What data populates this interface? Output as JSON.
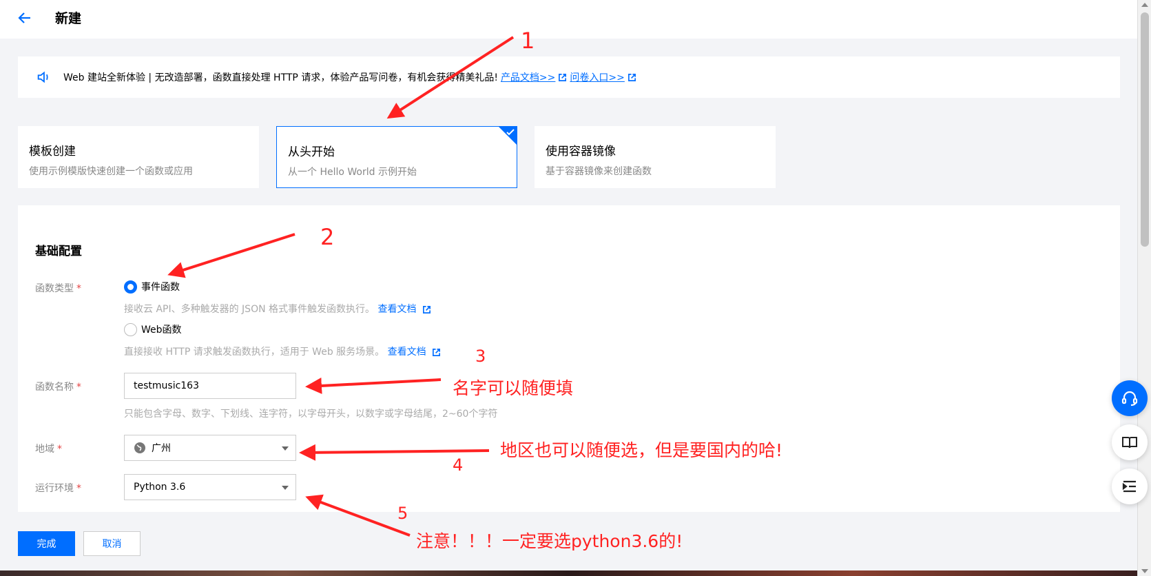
{
  "header": {
    "title": "新建"
  },
  "notice": {
    "text": "Web 建站全新体验 | 无改造部署，函数直接处理 HTTP 请求，体验产品写问卷，有机会获得精美礼品!",
    "link1": "产品文档>>",
    "link2": "问卷入口>>"
  },
  "cards": [
    {
      "title": "模板创建",
      "desc": "使用示例模版快速创建一个函数或应用"
    },
    {
      "title": "从头开始",
      "desc": "从一个 Hello World 示例开始"
    },
    {
      "title": "使用容器镜像",
      "desc": "基于容器镜像来创建函数"
    }
  ],
  "form": {
    "section_title": "基础配置",
    "type_label": "函数类型",
    "required_mark": "*",
    "radio_event": "事件函数",
    "radio_event_help": "接收云 API、多种触发器的 JSON 格式事件触发函数执行。",
    "radio_web": "Web函数",
    "radio_web_help": "直接接收 HTTP 请求触发函数执行，适用于 Web 服务场景。",
    "doc_link": "查看文档",
    "name_label": "函数名称",
    "name_value": "testmusic163",
    "name_help": "只能包含字母、数字、下划线、连字符，以字母开头，以数字或字母结尾，2~60个字符",
    "region_label": "地域",
    "region_value": "广州",
    "runtime_label": "运行环境",
    "runtime_value": "Python 3.6"
  },
  "buttons": {
    "done": "完成",
    "cancel": "取消"
  },
  "annotations": {
    "n1": "1",
    "n2": "2",
    "n3": "3",
    "n4": "4",
    "n5": "5",
    "t3": "名字可以随便填",
    "t4": "地区也可以随便选，但是要国内的哈!",
    "t5": "注意！！！一定要选python3.6的!"
  },
  "colors": {
    "accent": "#006eff",
    "annotation": "#ff2222"
  }
}
